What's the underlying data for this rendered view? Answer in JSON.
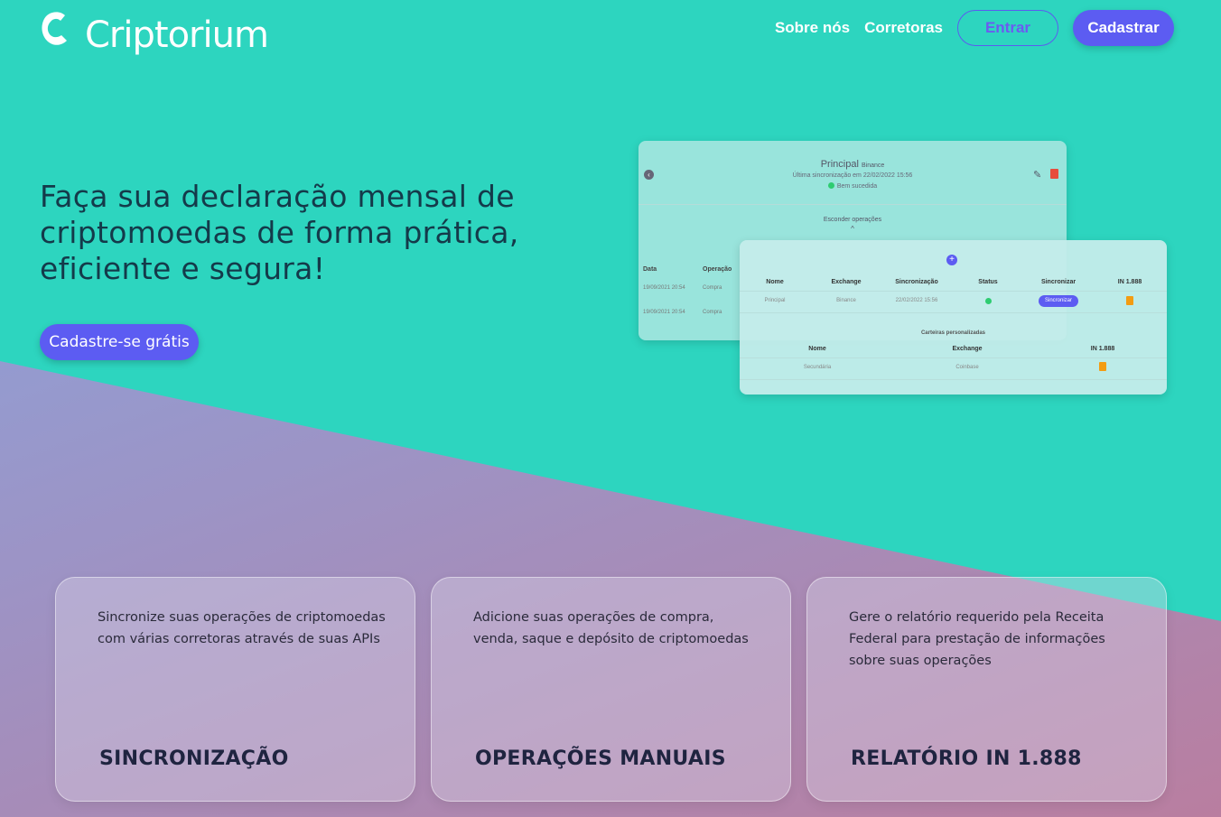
{
  "brand": {
    "name": "Criptorium",
    "logo_icon": "c-logo-icon"
  },
  "nav": {
    "about": "Sobre nós",
    "brokers": "Corretoras",
    "login": "Entrar",
    "signup": "Cadastrar"
  },
  "hero": {
    "title": "Faça sua declaração mensal de criptomoedas de forma prática, eficiente e segura!",
    "cta": "Cadastre-se grátis"
  },
  "mockup": {
    "wallet": {
      "title": "Principal",
      "exchange": "Binance",
      "last_sync": "Última sincronização em 22/02/2022 15:56",
      "status": "Bem sucedida",
      "hide_ops": "Esconder operações",
      "columns": [
        "Data",
        "Operação"
      ],
      "rows": [
        [
          "19/09/2021 20:54",
          "Compra"
        ],
        [
          "19/09/2021 20:54",
          "Compra"
        ]
      ]
    },
    "table": {
      "columns": [
        "Nome",
        "Exchange",
        "Sincronização",
        "Status",
        "Sincronizar",
        "IN 1.888"
      ],
      "row": {
        "name": "Principal",
        "exchange": "Binance",
        "sync_date": "22/02/2022 15:56",
        "sync_button": "Sincronizar"
      },
      "custom_section": "Carteiras personalizadas",
      "custom_columns": [
        "Nome",
        "Exchange",
        "IN 1.888"
      ],
      "custom_row": {
        "name": "Secundária",
        "exchange": "Coinbase"
      }
    }
  },
  "features": [
    {
      "text": "Sincronize suas operações de criptomoedas com várias corretoras através de suas APIs",
      "title": "SINCRONIZAÇÃO"
    },
    {
      "text": "Adicione suas operações de compra, venda, saque e depósito de criptomoedas",
      "title": "OPERAÇÕES MANUAIS"
    },
    {
      "text": "Gere o relatório requerido pela Receita Federal para prestação de informações sobre suas operações",
      "title": "RELATÓRIO IN 1.888"
    }
  ],
  "colors": {
    "background": "#2dd5bf",
    "accent": "#5c5cf2",
    "heading": "#143a4a"
  }
}
